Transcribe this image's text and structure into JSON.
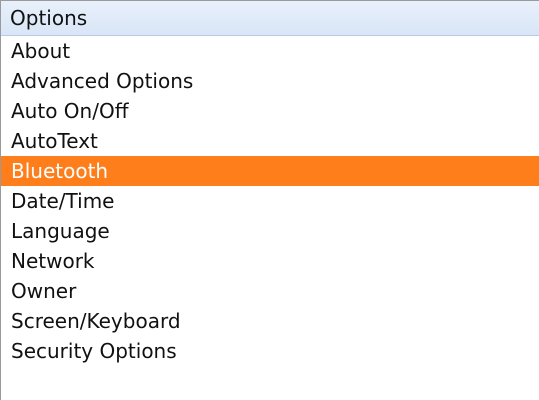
{
  "screen": {
    "title": "Options",
    "selected_index": 4,
    "accent_color": "#ff7e1c",
    "title_bar_color": "#dde8f7",
    "items": [
      {
        "label": "About"
      },
      {
        "label": "Advanced Options"
      },
      {
        "label": "Auto On/Off"
      },
      {
        "label": "AutoText"
      },
      {
        "label": "Bluetooth"
      },
      {
        "label": "Date/Time"
      },
      {
        "label": "Language"
      },
      {
        "label": "Network"
      },
      {
        "label": "Owner"
      },
      {
        "label": "Screen/Keyboard"
      },
      {
        "label": "Security Options"
      }
    ]
  }
}
